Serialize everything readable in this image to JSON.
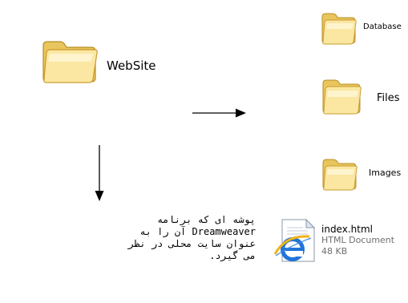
{
  "folders": {
    "website": {
      "label": "WebSite",
      "icon": "folder-icon"
    },
    "database": {
      "label": "Database",
      "icon": "folder-icon"
    },
    "files": {
      "label": "Files",
      "icon": "folder-icon"
    },
    "images": {
      "label": "Images",
      "icon": "folder-icon"
    }
  },
  "file": {
    "name": "index.html",
    "type": "HTML Document",
    "size": "48 KB",
    "icon": "internet-explorer-icon"
  },
  "description": {
    "lines": [
      "پوشه ای که برنامه",
      "Dreamweaver آن را به",
      "عنوان سایت محلی در نظر",
      "می گیرد."
    ]
  },
  "colors": {
    "folder_light": "#fdf2b8",
    "folder_mid": "#f4d873",
    "folder_dark": "#d6ab3a",
    "folder_edge": "#b88d22",
    "arrow": "#000000",
    "file_meta_text": "#6f6f6f"
  }
}
